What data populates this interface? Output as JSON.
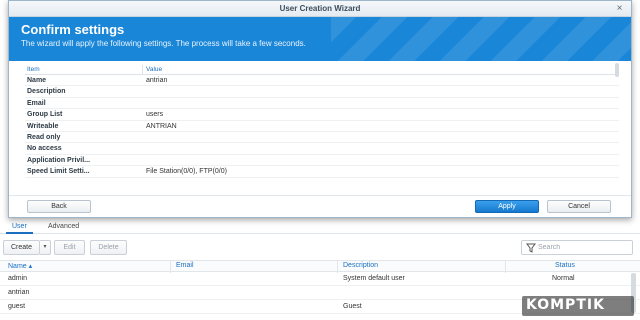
{
  "dialog": {
    "title": "User Creation Wizard",
    "close_glyph": "×",
    "banner_title": "Confirm settings",
    "banner_subtitle": "The wizard will apply the following settings. The process will take a few seconds.",
    "table_headers": {
      "item": "Item",
      "value": "Value"
    },
    "settings": [
      {
        "item": "Name",
        "value": "antrian"
      },
      {
        "item": "Description",
        "value": ""
      },
      {
        "item": "Email",
        "value": ""
      },
      {
        "item": "Group List",
        "value": "users"
      },
      {
        "item": "Writeable",
        "value": "ANTRIAN"
      },
      {
        "item": "Read only",
        "value": ""
      },
      {
        "item": "No access",
        "value": ""
      },
      {
        "item": "Application Privil...",
        "value": ""
      },
      {
        "item": "Speed Limit Setti...",
        "value": "File Station(0/0), FTP(0/0)"
      }
    ],
    "buttons": {
      "back": "Back",
      "apply": "Apply",
      "cancel": "Cancel"
    }
  },
  "user_panel": {
    "tabs": [
      {
        "label": "User",
        "active": true
      },
      {
        "label": "Advanced",
        "active": false
      }
    ],
    "toolbar": {
      "create": "Create",
      "edit": "Edit",
      "delete": "Delete",
      "search_placeholder": "Search"
    },
    "columns": {
      "name": "Name ▴",
      "email": "Email",
      "description": "Description",
      "status": "Status"
    },
    "rows": [
      {
        "name": "admin",
        "email": "",
        "description": "System default user",
        "status": "Normal"
      },
      {
        "name": "antrian",
        "email": "",
        "description": "",
        "status": ""
      },
      {
        "name": "guest",
        "email": "",
        "description": "Guest",
        "status": ""
      }
    ]
  },
  "watermark": {
    "text": "KOMPTIK"
  },
  "colors": {
    "accent": "#1a86d8",
    "link": "#1a6fc2"
  }
}
